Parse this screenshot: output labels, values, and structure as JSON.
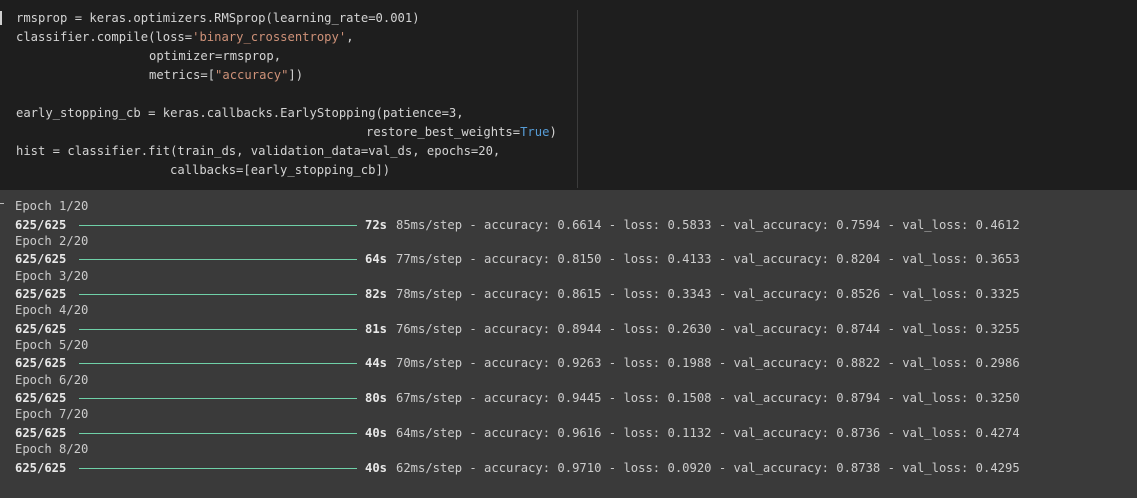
{
  "code": {
    "line1": "rmsprop = keras.optimizers.RMSprop(learning_rate=0.001)",
    "line2_a": "classifier.compile(loss=",
    "line2_str": "'binary_crossentropy'",
    "line2_b": ",",
    "line3": "optimizer=rmsprop,",
    "line4_a": "metrics=[",
    "line4_str": "\"accuracy\"",
    "line4_b": "])",
    "line6": "early_stopping_cb = keras.callbacks.EarlyStopping(patience=3,",
    "line7_a": "restore_best_weights=",
    "line7_kw": "True",
    "line7_b": ")",
    "line8": "hist = classifier.fit(train_ds, validation_data=val_ds, epochs=20,",
    "line9": "callbacks=[early_stopping_cb])"
  },
  "epochs": [
    {
      "label": "Epoch 1/20",
      "steps": "625/625",
      "time": "72s",
      "metrics": "85ms/step - accuracy: 0.6614 - loss: 0.5833 - val_accuracy: 0.7594 - val_loss: 0.4612"
    },
    {
      "label": "Epoch 2/20",
      "steps": "625/625",
      "time": "64s",
      "metrics": "77ms/step - accuracy: 0.8150 - loss: 0.4133 - val_accuracy: 0.8204 - val_loss: 0.3653"
    },
    {
      "label": "Epoch 3/20",
      "steps": "625/625",
      "time": "82s",
      "metrics": "78ms/step - accuracy: 0.8615 - loss: 0.3343 - val_accuracy: 0.8526 - val_loss: 0.3325"
    },
    {
      "label": "Epoch 4/20",
      "steps": "625/625",
      "time": "81s",
      "metrics": "76ms/step - accuracy: 0.8944 - loss: 0.2630 - val_accuracy: 0.8744 - val_loss: 0.3255"
    },
    {
      "label": "Epoch 5/20",
      "steps": "625/625",
      "time": "44s",
      "metrics": "70ms/step - accuracy: 0.9263 - loss: 0.1988 - val_accuracy: 0.8822 - val_loss: 0.2986"
    },
    {
      "label": "Epoch 6/20",
      "steps": "625/625",
      "time": "80s",
      "metrics": "67ms/step - accuracy: 0.9445 - loss: 0.1508 - val_accuracy: 0.8794 - val_loss: 0.3250"
    },
    {
      "label": "Epoch 7/20",
      "steps": "625/625",
      "time": "40s",
      "metrics": "64ms/step - accuracy: 0.9616 - loss: 0.1132 - val_accuracy: 0.8736 - val_loss: 0.4274"
    },
    {
      "label": "Epoch 8/20",
      "steps": "625/625",
      "time": "40s",
      "metrics": "62ms/step - accuracy: 0.9710 - loss: 0.0920 - val_accuracy: 0.8738 - val_loss: 0.4295"
    }
  ],
  "colors": {
    "code_bg": "#1e1e1e",
    "output_bg": "#3a3a3a",
    "progress_bar": "#6fd0a8",
    "string": "#ce9178",
    "keyword": "#569cd6"
  }
}
